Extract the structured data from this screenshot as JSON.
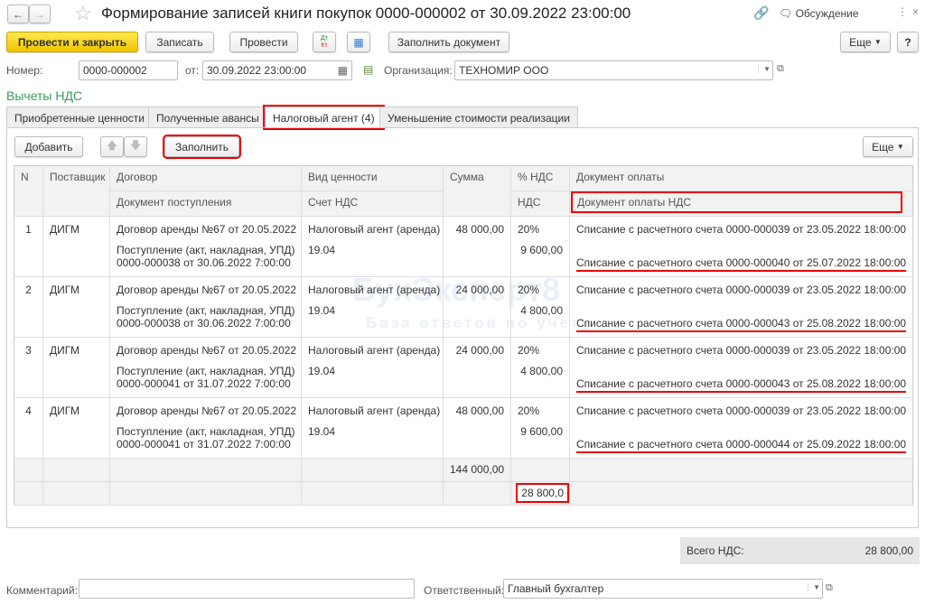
{
  "window": {
    "title": "Формирование записей книги покупок 0000-000002 от 30.09.2022 23:00:00",
    "discussion": "Обсуждение"
  },
  "toolbar": {
    "post_close": "Провести и закрыть",
    "save": "Записать",
    "post": "Провести",
    "dtkt_top": "Дт",
    "dtkt_bottom": "Кт",
    "fill_doc": "Заполнить документ",
    "more": "Еще",
    "help": "?"
  },
  "header": {
    "number_label": "Номер:",
    "number": "0000-000002",
    "date_label": "от:",
    "date": "30.09.2022 23:00:00",
    "org_label": "Организация:",
    "org": "ТЕХНОМИР ООО"
  },
  "section_title": "Вычеты НДС",
  "tabs": [
    "Приобретенные ценности",
    "Полученные авансы",
    "Налоговый агент (4)",
    "Уменьшение стоимости реализации"
  ],
  "table_toolbar": {
    "add": "Добавить",
    "fill": "Заполнить",
    "more": "Еще"
  },
  "columns": {
    "n": "N",
    "supplier": "Поставщик",
    "contract": "Договор",
    "receipt_doc": "Документ поступления",
    "value_type": "Вид ценности",
    "vat_account": "Счет НДС",
    "amount": "Сумма",
    "vat_rate": "% НДС",
    "vat": "НДС",
    "payment_doc": "Документ оплаты",
    "vat_payment_doc": "Документ оплаты НДС"
  },
  "rows": [
    {
      "n": "1",
      "supplier": "ДИГМ",
      "contract": "Договор аренды №67 от 20.05.2022",
      "receipt_1": "Поступление (акт, накладная, УПД)",
      "receipt_2": "0000-000038 от 30.06.2022 7:00:00",
      "value_type": "Налоговый агент (аренда)",
      "vat_account": "19.04",
      "amount": "48 000,00",
      "vat_rate": "20%",
      "vat": "9 600,00",
      "payment_doc": "Списание с расчетного счета 0000-000039 от 23.05.2022 18:00:00",
      "vat_payment_doc": "Списание с расчетного счета 0000-000040 от 25.07.2022 18:00:00"
    },
    {
      "n": "2",
      "supplier": "ДИГМ",
      "contract": "Договор аренды №67 от 20.05.2022",
      "receipt_1": "Поступление (акт, накладная, УПД)",
      "receipt_2": "0000-000038 от 30.06.2022 7:00:00",
      "value_type": "Налоговый агент (аренда)",
      "vat_account": "19.04",
      "amount": "24 000,00",
      "vat_rate": "20%",
      "vat": "4 800,00",
      "payment_doc": "Списание с расчетного счета 0000-000039 от 23.05.2022 18:00:00",
      "vat_payment_doc": "Списание с расчетного счета 0000-000043 от 25.08.2022 18:00:00"
    },
    {
      "n": "3",
      "supplier": "ДИГМ",
      "contract": "Договор аренды №67 от 20.05.2022",
      "receipt_1": "Поступление (акт, накладная, УПД)",
      "receipt_2": "0000-000041 от 31.07.2022 7:00:00",
      "value_type": "Налоговый агент (аренда)",
      "vat_account": "19.04",
      "amount": "24 000,00",
      "vat_rate": "20%",
      "vat": "4 800,00",
      "payment_doc": "Списание с расчетного счета 0000-000039 от 23.05.2022 18:00:00",
      "vat_payment_doc": "Списание с расчетного счета 0000-000043 от 25.08.2022 18:00:00"
    },
    {
      "n": "4",
      "supplier": "ДИГМ",
      "contract": "Договор аренды №67 от 20.05.2022",
      "receipt_1": "Поступление (акт, накладная, УПД)",
      "receipt_2": "0000-000041 от 31.07.2022 7:00:00",
      "value_type": "Налоговый агент (аренда)",
      "vat_account": "19.04",
      "amount": "48 000,00",
      "vat_rate": "20%",
      "vat": "9 600,00",
      "payment_doc": "Списание с расчетного счета 0000-000039 от 23.05.2022 18:00:00",
      "vat_payment_doc": "Списание с расчетного счета 0000-000044 от 25.09.2022 18:00:00"
    }
  ],
  "totals": {
    "amount": "144 000,00",
    "vat": "28 800,0"
  },
  "summary": {
    "label": "Всего НДС:",
    "value": "28 800,00"
  },
  "footer": {
    "comment_label": "Комментарий:",
    "comment": "",
    "responsible_label": "Ответственный:",
    "responsible": "Главный бухгалтер"
  },
  "watermark": {
    "brand": "БухЭксперт8",
    "tagline": "База ответов по учету"
  }
}
